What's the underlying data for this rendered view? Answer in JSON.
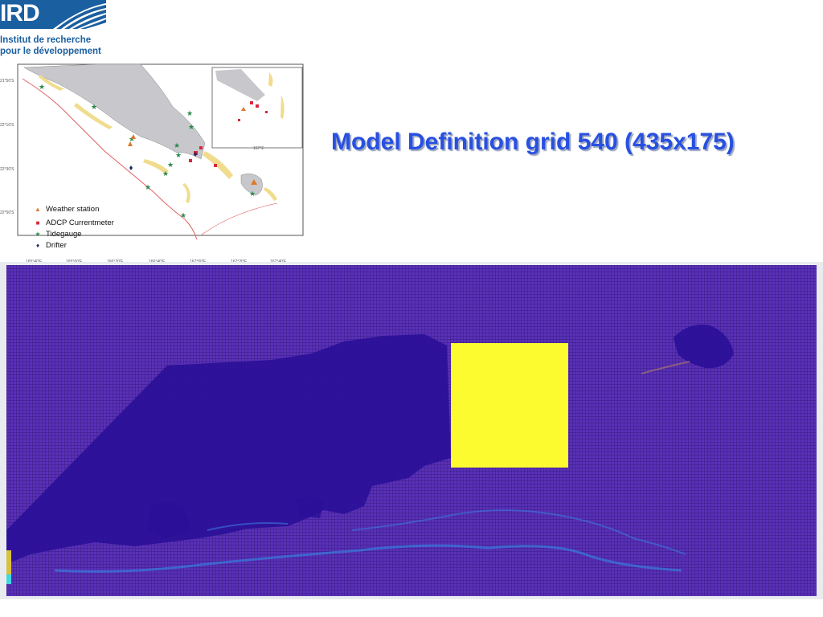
{
  "logo": {
    "text": "IRD",
    "line1": "Institut de recherche",
    "line2": "pour le développement"
  },
  "title": "Model Definition grid 540 (435x175)",
  "mini_map": {
    "lat_labels": [
      "21°50'S",
      "22°10'S",
      "22°30'S",
      "22°50'S"
    ],
    "lon_labels": [
      "165°40'E",
      "165°60'E",
      "166°20'E",
      "166°40'E",
      "167°00'E",
      "167°20'E",
      "167°40'E"
    ],
    "inset_label": "167°E",
    "legend": [
      {
        "symbol": "triangle",
        "color": "#e07828",
        "label": "Weather station"
      },
      {
        "symbol": "square",
        "color": "#d8283c",
        "label": "ADCP Currentmeter"
      },
      {
        "symbol": "star",
        "color": "#2a8a4a",
        "label": "Tidegauge"
      },
      {
        "symbol": "diamond",
        "color": "#1a2a6a",
        "label": "Drifter"
      }
    ]
  },
  "colors": {
    "title": "#2850e0",
    "grid_background": "#5a30b8",
    "grid_lines": "#2b1670",
    "land_mask": "#2a0f98",
    "highlight_box": "#fbfb30",
    "logo_blue": "#1a5fa0"
  }
}
